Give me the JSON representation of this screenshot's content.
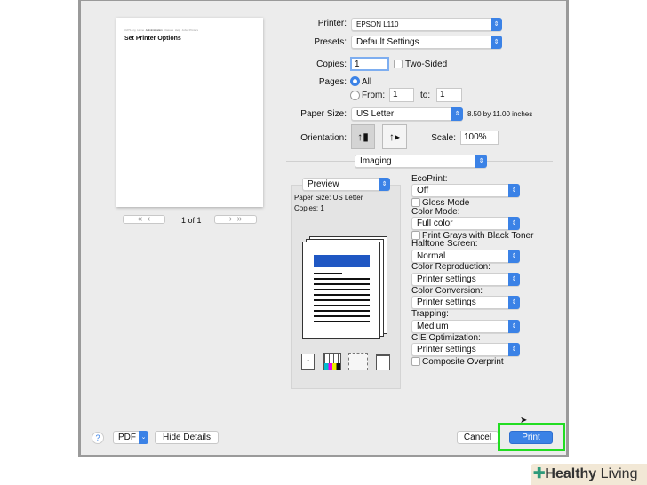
{
  "preview_page": {
    "title": "Set Printer Options",
    "nav": [
      "CUPS.org",
      "Home",
      "Administration",
      "Classes",
      "Help",
      "Jobs",
      "Printers"
    ],
    "page_indicator": "1 of 1"
  },
  "printer": {
    "label": "Printer:",
    "value": "EPSON L110"
  },
  "presets": {
    "label": "Presets:",
    "value": "Default Settings"
  },
  "copies": {
    "label": "Copies:",
    "value": "1",
    "two_sided": "Two-Sided"
  },
  "pages": {
    "label": "Pages:",
    "all": "All",
    "from": "From:",
    "from_value": "1",
    "to": "to:",
    "to_value": "1"
  },
  "paper_size": {
    "label": "Paper Size:",
    "value": "US Letter",
    "dimensions": "8.50 by 11.00 inches"
  },
  "orientation": {
    "label": "Orientation:"
  },
  "scale": {
    "label": "Scale:",
    "value": "100%"
  },
  "section": {
    "value": "Imaging"
  },
  "preview_panel": {
    "select": "Preview",
    "paper_size": "Paper Size: US Letter",
    "copies": "Copies: 1"
  },
  "options": {
    "ecoprint": {
      "label": "EcoPrint:",
      "value": "Off"
    },
    "gloss": "Gloss Mode",
    "color_mode": {
      "label": "Color Mode:",
      "value": "Full color"
    },
    "grays": "Print Grays with Black Toner",
    "halftone": {
      "label": "Halftone Screen:",
      "value": "Normal"
    },
    "color_repro": {
      "label": "Color Reproduction:",
      "value": "Printer settings"
    },
    "color_conv": {
      "label": "Color Conversion:",
      "value": "Printer settings"
    },
    "trapping": {
      "label": "Trapping:",
      "value": "Medium"
    },
    "cie": {
      "label": "CIE Optimization:",
      "value": "Printer settings"
    },
    "overprint": "Composite Overprint"
  },
  "footer": {
    "help": "?",
    "pdf": "PDF",
    "hide_details": "Hide Details",
    "cancel": "Cancel",
    "print": "Print"
  },
  "watermark": {
    "brand": "Healthy",
    "brand2": "Living"
  },
  "colors": {
    "accent": "#3b82e6",
    "highlight": "#22dd22"
  }
}
